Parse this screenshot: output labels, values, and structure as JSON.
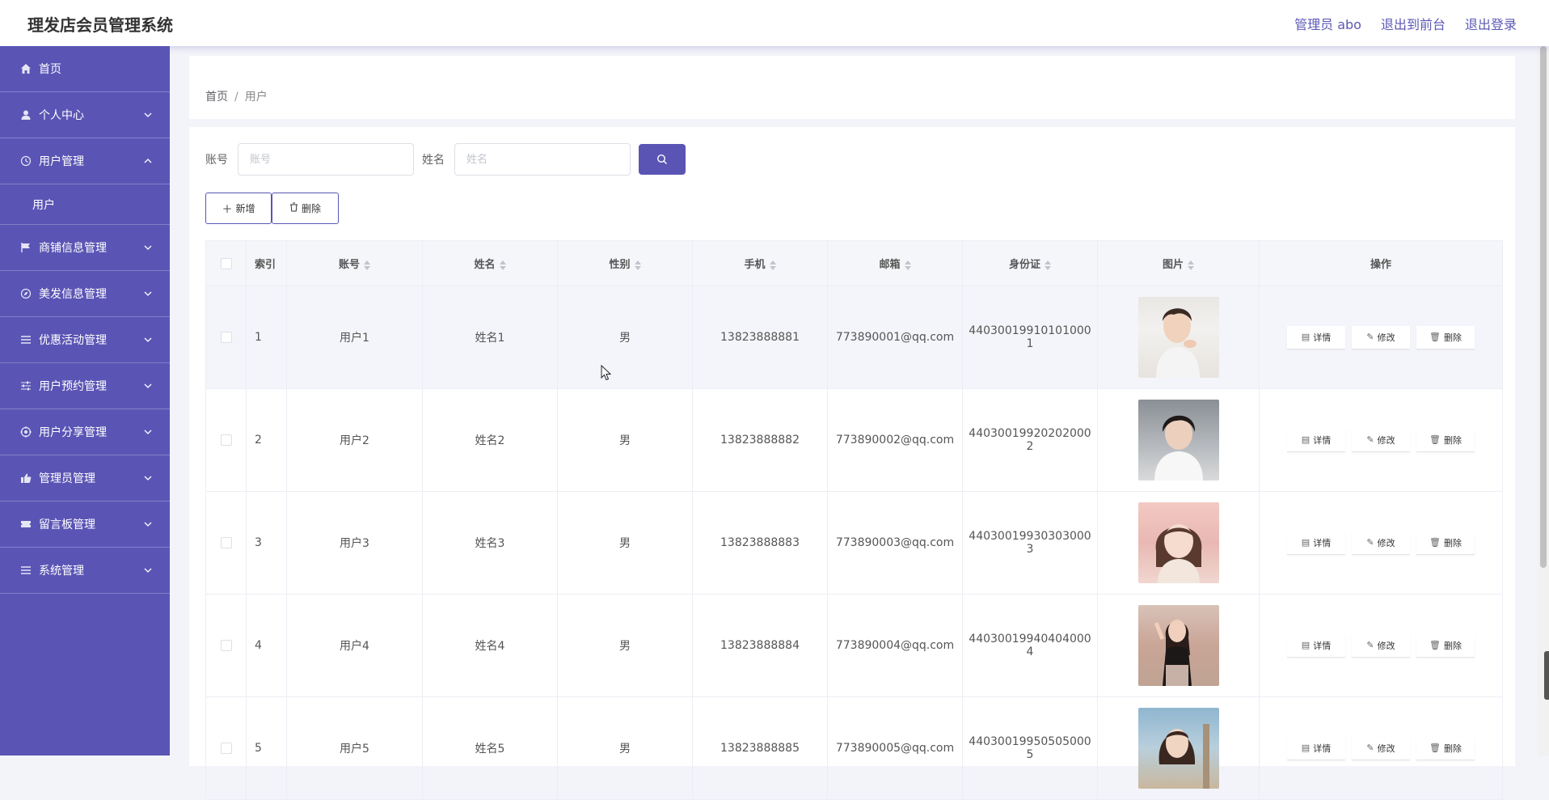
{
  "header": {
    "app_title": "理发店会员管理系统",
    "admin_label": "管理员 abo",
    "to_frontend": "退出到前台",
    "logout": "退出登录"
  },
  "sidebar": {
    "items": [
      {
        "label": "首页",
        "icon": "home-icon"
      },
      {
        "label": "个人中心",
        "icon": "user-icon"
      },
      {
        "label": "用户管理",
        "icon": "clock-icon",
        "expanded": true,
        "sub": "用户"
      },
      {
        "label": "商铺信息管理",
        "icon": "flag-icon"
      },
      {
        "label": "美发信息管理",
        "icon": "compass-icon"
      },
      {
        "label": "优惠活动管理",
        "icon": "menu-icon"
      },
      {
        "label": "用户预约管理",
        "icon": "sliders-icon"
      },
      {
        "label": "用户分享管理",
        "icon": "target-icon"
      },
      {
        "label": "管理员管理",
        "icon": "thumb-icon"
      },
      {
        "label": "留言板管理",
        "icon": "ticket-icon"
      },
      {
        "label": "系统管理",
        "icon": "menu-icon"
      }
    ]
  },
  "breadcrumb": {
    "home": "首页",
    "sep": "/",
    "current": "用户"
  },
  "search": {
    "account_label": "账号",
    "account_placeholder": "账号",
    "name_label": "姓名",
    "name_placeholder": "姓名"
  },
  "actions": {
    "add": "新增",
    "delete": "删除"
  },
  "table": {
    "headers": [
      "索引",
      "账号",
      "姓名",
      "性别",
      "手机",
      "邮箱",
      "身份证",
      "图片",
      "操作"
    ],
    "rows": [
      {
        "index": "1",
        "account": "用户1",
        "name": "姓名1",
        "gender": "男",
        "phone": "13823888881",
        "email": "773890001@qq.com",
        "id_line1": "44030019910101000",
        "id_line2": "1"
      },
      {
        "index": "2",
        "account": "用户2",
        "name": "姓名2",
        "gender": "男",
        "phone": "13823888882",
        "email": "773890002@qq.com",
        "id_line1": "44030019920202000",
        "id_line2": "2"
      },
      {
        "index": "3",
        "account": "用户3",
        "name": "姓名3",
        "gender": "男",
        "phone": "13823888883",
        "email": "773890003@qq.com",
        "id_line1": "44030019930303000",
        "id_line2": "3"
      },
      {
        "index": "4",
        "account": "用户4",
        "name": "姓名4",
        "gender": "男",
        "phone": "13823888884",
        "email": "773890004@qq.com",
        "id_line1": "44030019940404000",
        "id_line2": "4"
      },
      {
        "index": "5",
        "account": "用户5",
        "name": "姓名5",
        "gender": "男",
        "phone": "13823888885",
        "email": "773890005@qq.com",
        "id_line1": "44030019950505000",
        "id_line2": "5"
      }
    ],
    "row_actions": {
      "detail": "详情",
      "edit": "修改",
      "delete": "删除"
    }
  },
  "colors": {
    "primary": "#5a55b5",
    "sidebar_bg": "#5a55b5",
    "page_bg": "#f3f4f9"
  }
}
